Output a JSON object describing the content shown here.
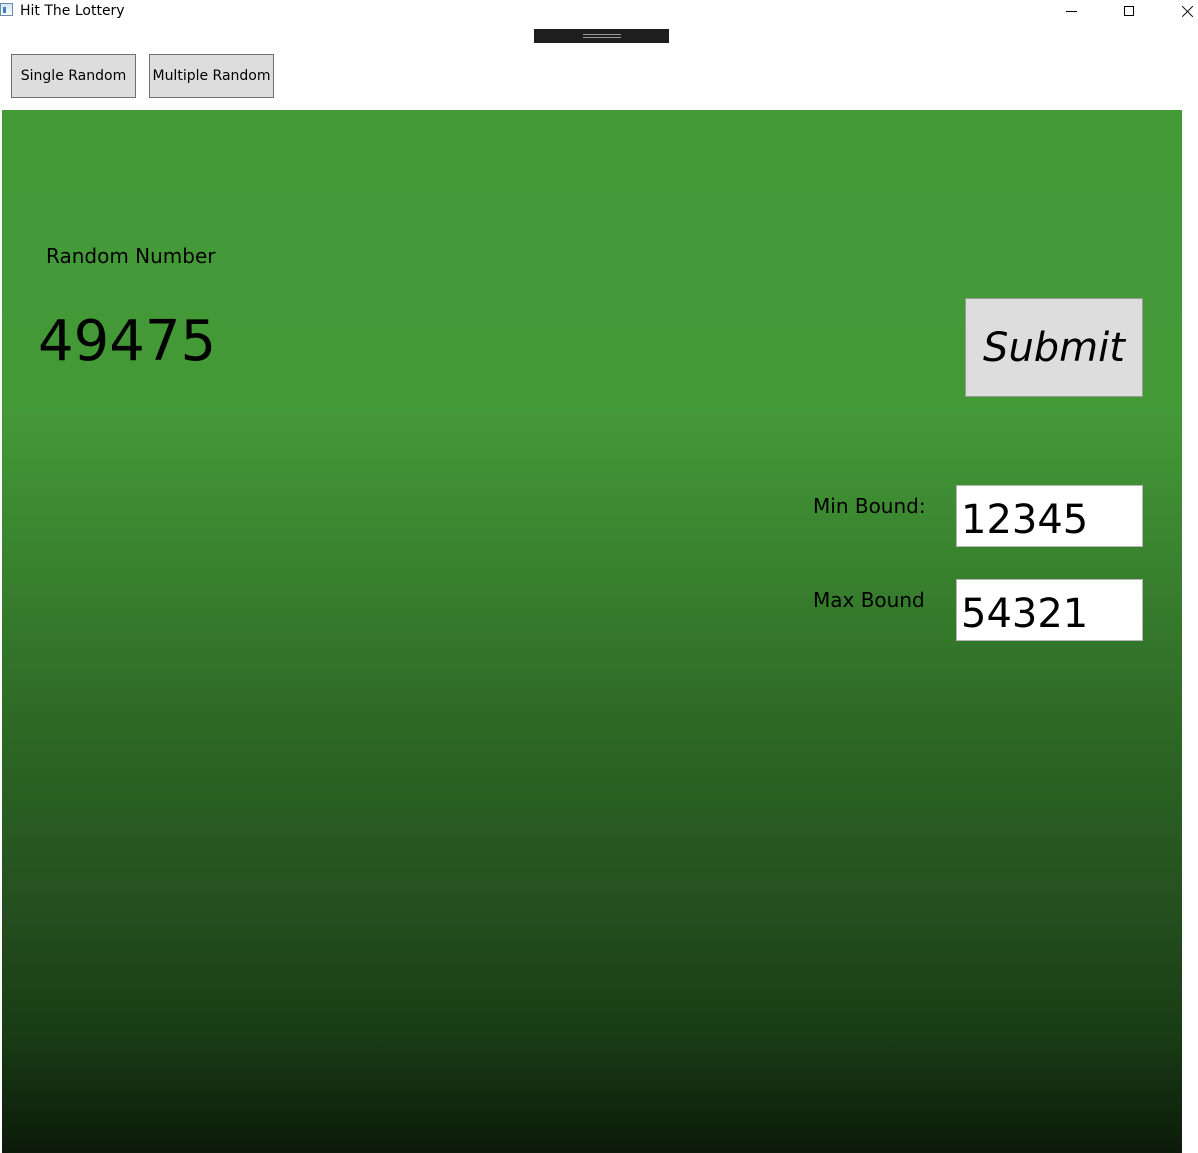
{
  "window": {
    "title": "Hit The Lottery",
    "controls": {
      "minimize_icon": "minimize-icon",
      "maximize_icon": "maximize-icon",
      "close_icon": "close-icon"
    }
  },
  "nav": {
    "single_label": "Single Random",
    "multiple_label": "Multiple Random"
  },
  "random": {
    "label": "Random Number",
    "value": "49475"
  },
  "submit": {
    "label": "Submit"
  },
  "bounds": {
    "min_label": "Min Bound:",
    "min_value": "12345",
    "max_label": "Max Bound",
    "max_value": "54321"
  },
  "colors": {
    "panel_top": "#459a38",
    "panel_bottom": "#0c1a0a",
    "button_bg": "#dddddd"
  }
}
